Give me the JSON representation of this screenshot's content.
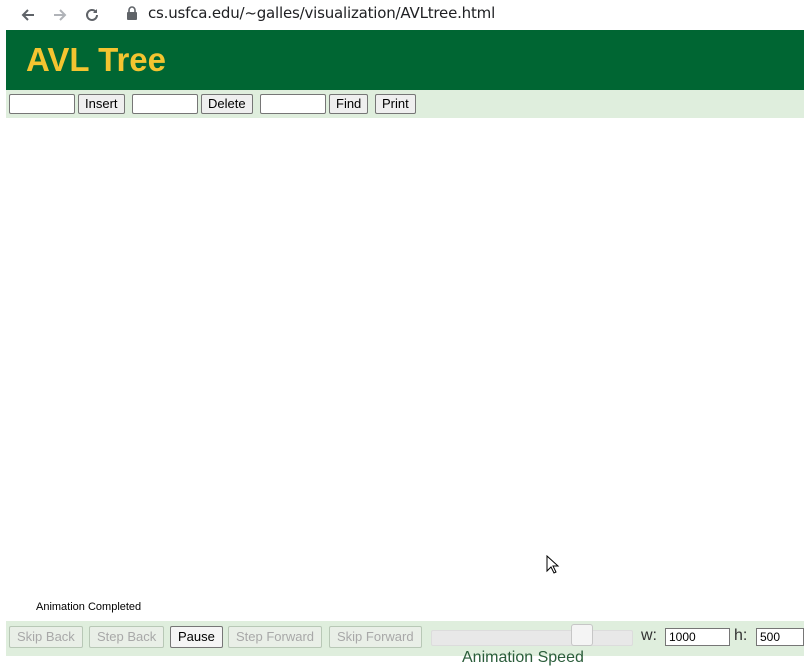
{
  "browser": {
    "url": "cs.usfca.edu/~galles/visualization/AVLtree.html"
  },
  "header": {
    "title": "AVL Tree"
  },
  "toolbar": {
    "insert_value": "",
    "insert_label": "Insert",
    "delete_value": "",
    "delete_label": "Delete",
    "find_value": "",
    "find_label": "Find",
    "print_label": "Print"
  },
  "status": {
    "text": "Animation Completed"
  },
  "controls": {
    "skip_back": "Skip Back",
    "step_back": "Step Back",
    "pause": "Pause",
    "step_forward": "Step Forward",
    "skip_forward": "Skip Forward",
    "speed_label": "Animation Speed",
    "speed_fraction": 0.75,
    "width_label": "w:",
    "width_value": "1000",
    "height_label": "h:",
    "height_value": "500"
  },
  "colors": {
    "header_bg": "#006633",
    "title_color": "#f4c430",
    "toolbar_bg": "#dfeedd"
  }
}
